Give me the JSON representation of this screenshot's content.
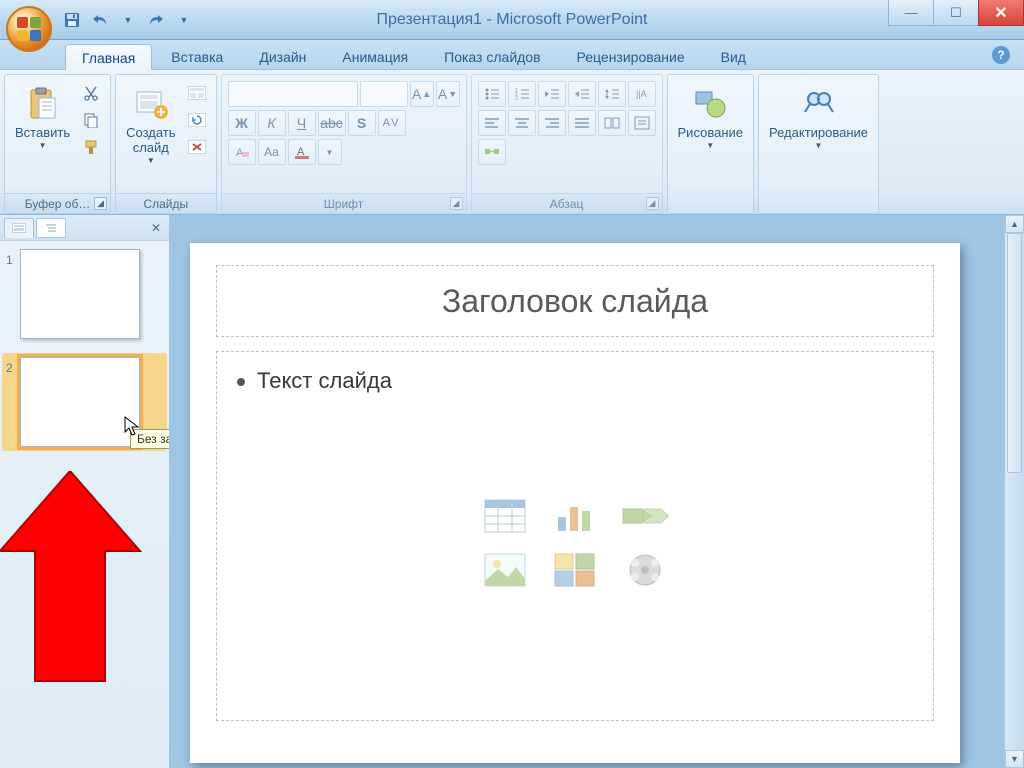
{
  "title": "Презентация1 - Microsoft PowerPoint",
  "tabs": {
    "home": "Главная",
    "insert": "Вставка",
    "design": "Дизайн",
    "animations": "Анимация",
    "slideshow": "Показ слайдов",
    "review": "Рецензирование",
    "view": "Вид"
  },
  "groups": {
    "clipboard": {
      "label": "Буфер об…",
      "paste": "Вставить"
    },
    "slides": {
      "label": "Слайды",
      "newslide": "Создать\nслайд"
    },
    "font": {
      "label": "Шрифт"
    },
    "paragraph": {
      "label": "Абзац"
    },
    "drawing": {
      "label": "Рисование"
    },
    "editing": {
      "label": "Редактирование"
    }
  },
  "thumbnails": {
    "slide1_num": "1",
    "slide2_num": "2"
  },
  "tooltip": "Без заголовка]",
  "slide": {
    "title_placeholder": "Заголовок слайда",
    "body_placeholder": "Текст слайда"
  },
  "content_icons": [
    "table-icon",
    "chart-icon",
    "smartart-icon",
    "picture-icon",
    "clipart-icon",
    "media-icon"
  ]
}
